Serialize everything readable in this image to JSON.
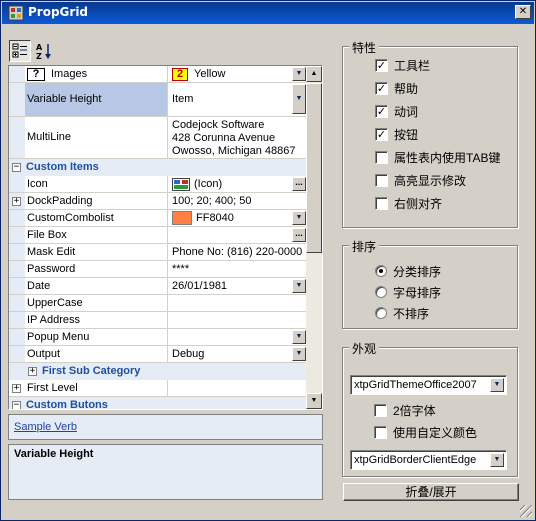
{
  "window": {
    "title": "PropGrid",
    "close_glyph": "✕"
  },
  "toolbar": {
    "categorized_icon": "categorized-icon",
    "alphabetic_icon": "alphabetic-sort-icon",
    "alpha_label": "A↓Z"
  },
  "grid": {
    "images": {
      "name": "Images",
      "value": "Yellow",
      "name_icon_text": "?",
      "value_icon_text": "2",
      "value_icon_color": "#ffff00"
    },
    "variable_height": {
      "name": "Variable Height",
      "value": "Item"
    },
    "multiline": {
      "name": "MultiLine",
      "line1": "Codejock Software",
      "line2": "428 Corunna Avenue",
      "line3": "Owosso, Michigan 48867"
    },
    "custom_items": {
      "label": "Custom Items"
    },
    "icon": {
      "name": "Icon",
      "value": "(Icon)"
    },
    "dockpadding": {
      "name": "DockPadding",
      "value": "100; 20; 400; 50"
    },
    "custom_combolist": {
      "name": "CustomCombolist",
      "value": "FF8040",
      "swatch_color": "#ff8040"
    },
    "file_box": {
      "name": "File Box",
      "value": ""
    },
    "mask_edit": {
      "name": "Mask Edit",
      "value": "Phone No: (816) 220-0000"
    },
    "password": {
      "name": "Password",
      "value": "****"
    },
    "date": {
      "name": "Date",
      "value": "26/01/1981"
    },
    "uppercase": {
      "name": "UpperCase",
      "value": ""
    },
    "ip_address": {
      "name": "IP Address",
      "value": ""
    },
    "popup_menu": {
      "name": "Popup Menu",
      "value": ""
    },
    "output": {
      "name": "Output",
      "value": "Debug"
    },
    "first_sub_category": {
      "label": "First Sub Category"
    },
    "first_level": {
      "name": "First Level",
      "value": ""
    },
    "custom_butons": {
      "label": "Custom Butons"
    },
    "expand_glyph": "+",
    "collapse_glyph": "−",
    "dots": "..."
  },
  "verb": {
    "label": "Sample Verb"
  },
  "help": {
    "title": "Variable Height"
  },
  "features": {
    "title": "特性",
    "items": [
      {
        "label": "工具栏",
        "mark": "✓"
      },
      {
        "label": "帮助",
        "mark": "✓"
      },
      {
        "label": "动词",
        "mark": "✓"
      },
      {
        "label": "按钮",
        "mark": "✓"
      },
      {
        "label": "属性表内使用TAB键",
        "mark": ""
      },
      {
        "label": "高亮显示修改",
        "mark": ""
      },
      {
        "label": "右侧对齐",
        "mark": ""
      }
    ]
  },
  "sort": {
    "title": "排序",
    "items": [
      {
        "label": "分类排序"
      },
      {
        "label": "字母排序"
      },
      {
        "label": "不排序"
      }
    ],
    "selected_index": 0
  },
  "appearance": {
    "title": "外观",
    "theme_value": "xtpGridThemeOffice2007",
    "double_font": {
      "label": "2倍字体",
      "mark": ""
    },
    "custom_colors": {
      "label": "使用自定义颜色",
      "mark": ""
    },
    "border_value": "xtpGridBorderClientEdge",
    "collapse_button": "折叠/展开"
  },
  "colors": {
    "category_text": "#1f4f9f",
    "category_bg": "#e6ecf5",
    "selected_bg": "#b7c8e7",
    "title_bar": "#0b5ad8"
  }
}
